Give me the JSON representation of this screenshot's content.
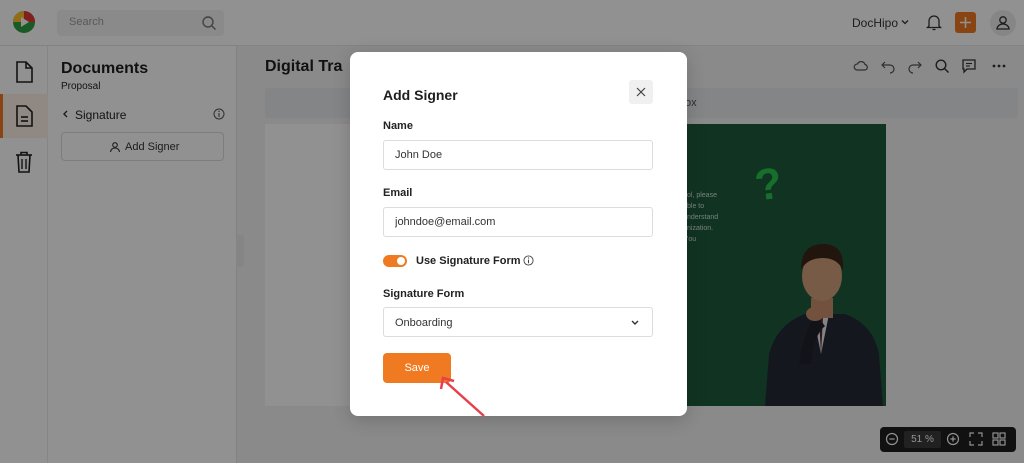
{
  "topbar": {
    "search_placeholder": "Search",
    "brand_name": "DocHipo"
  },
  "panel": {
    "title": "Documents",
    "subtitle": "Proposal",
    "section": "Signature",
    "add_signer_label": "Add Signer"
  },
  "editor": {
    "doc_title": "Digital Tra",
    "toolbar_text": "ox",
    "canvas_text_lines": [
      "ol, please",
      "ble to",
      "nderstand",
      "nization.",
      "'ou"
    ],
    "zoom_value": "51",
    "zoom_unit": "%"
  },
  "modal": {
    "title": "Add Signer",
    "name_label": "Name",
    "name_value": "John Doe",
    "email_label": "Email",
    "email_value": "johndoe@email.com",
    "toggle_label": "Use Signature Form",
    "toggle_on": true,
    "signature_form_label": "Signature Form",
    "signature_form_value": "Onboarding",
    "save_label": "Save"
  },
  "colors": {
    "accent": "#f07a22",
    "canvas_green": "#1f5a3d",
    "annotation_arrow": "#e8404a"
  },
  "icons": [
    "logo-icon",
    "search-icon",
    "chevron-down-icon",
    "bell-icon",
    "plus-icon",
    "user-icon",
    "document-icon",
    "page-icon",
    "trash-icon",
    "chevron-left-icon",
    "info-icon",
    "add-user-icon",
    "cloud-icon",
    "undo-icon",
    "redo-icon",
    "comment-icon",
    "more-icon",
    "zoom-out-icon",
    "zoom-in-icon",
    "fullscreen-icon",
    "grid-icon",
    "close-icon"
  ]
}
